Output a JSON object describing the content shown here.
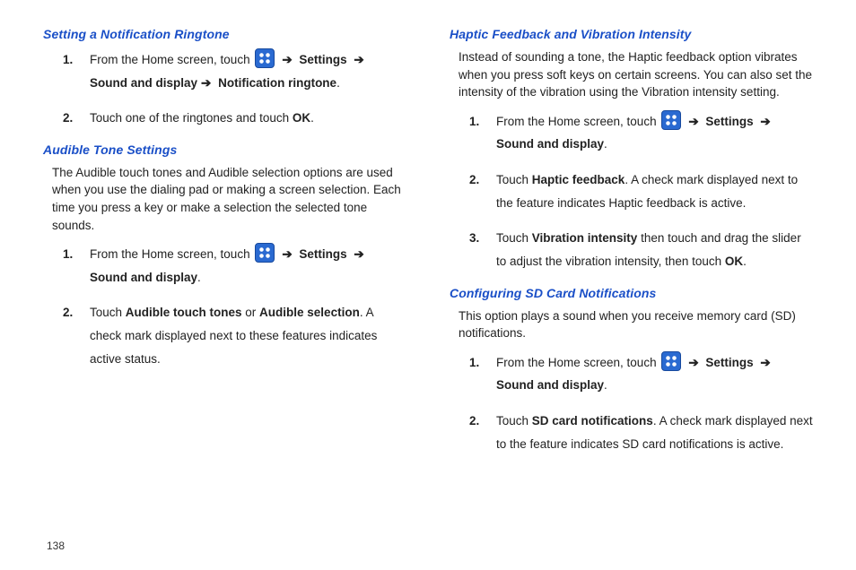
{
  "page_number": "138",
  "left": {
    "sec1": {
      "title": "Setting a Notification Ringtone",
      "step1_a": "From the Home screen, touch ",
      "step1_b": " Settings ",
      "step1_c": " Sound and display",
      "step1_d": " Notification ringtone",
      "step2_a": "Touch one of the ringtones and touch ",
      "step2_b": "OK"
    },
    "sec2": {
      "title": "Audible Tone Settings",
      "para": "The Audible touch tones and Audible selection options are used when you use the dialing pad or making a screen selection. Each time you press a key or make a selection the selected tone sounds.",
      "step1_a": "From the Home screen, touch ",
      "step1_b": " Settings ",
      "step1_c": " Sound and display",
      "step2_a": "Touch ",
      "step2_b": "Audible touch tones",
      "step2_c": " or ",
      "step2_d": "Audible selection",
      "step2_e": ". A check mark displayed next to these features indicates active status."
    }
  },
  "right": {
    "sec1": {
      "title": "Haptic Feedback and Vibration Intensity",
      "para": "Instead of sounding a tone, the Haptic feedback option vibrates when you press soft keys on certain screens. You can also set the intensity of the vibration using the Vibration intensity setting.",
      "step1_a": "From the Home screen, touch ",
      "step1_b": " Settings ",
      "step1_c": " Sound and display",
      "step2_a": "Touch ",
      "step2_b": "Haptic feedback",
      "step2_c": ". A check mark displayed next to the feature indicates Haptic feedback is active.",
      "step3_a": "Touch ",
      "step3_b": "Vibration intensity",
      "step3_c": " then touch and drag the slider to adjust the vibration intensity, then touch ",
      "step3_d": "OK"
    },
    "sec2": {
      "title": "Configuring SD Card Notifications",
      "para": "This option plays a sound when you receive memory card (SD) notifications.",
      "step1_a": "From the Home screen, touch ",
      "step1_b": " Settings ",
      "step1_c": " Sound and display",
      "step2_a": "Touch ",
      "step2_b": "SD card notifications",
      "step2_c": ". A check mark displayed next to the feature indicates SD card notifications is active."
    }
  }
}
